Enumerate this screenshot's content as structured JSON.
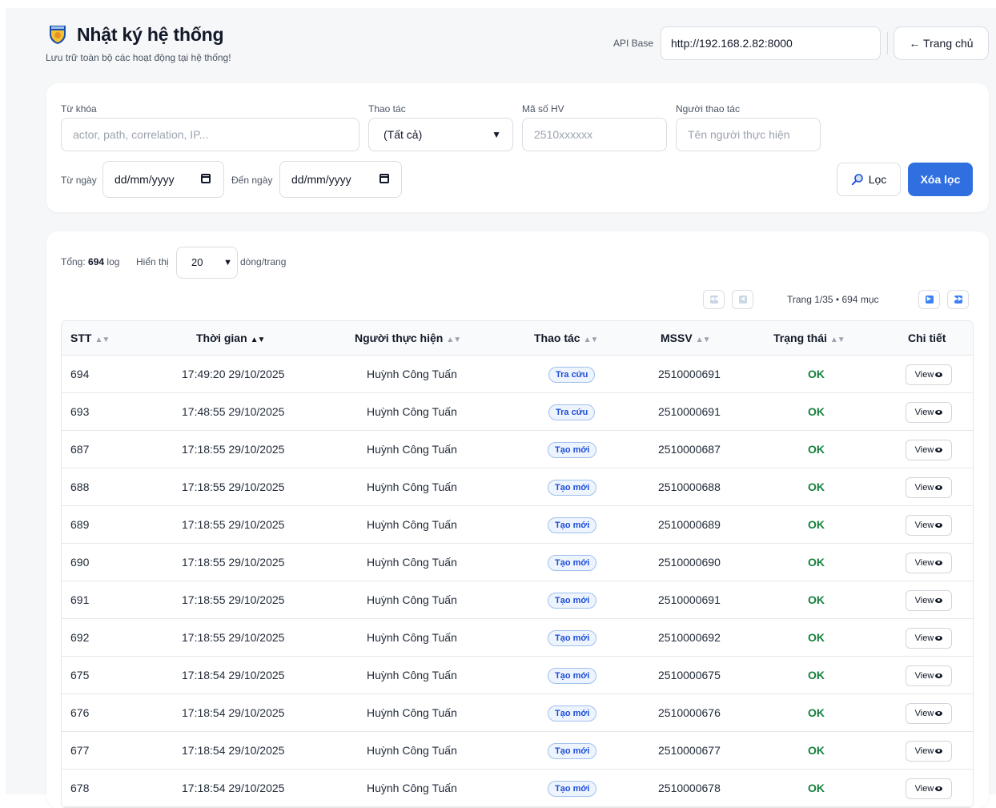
{
  "header": {
    "title": "Nhật ký hệ thống",
    "subtitle": "Lưu trữ toàn bộ các hoạt động tại hệ thống!",
    "api_label": "API Base",
    "api_value": "http://192.168.2.82:8000",
    "home_label": "← Trang chủ"
  },
  "filters": {
    "keyword_label": "Từ khóa",
    "keyword_placeholder": "actor, path, correlation, IP...",
    "action_label": "Thao tác",
    "action_value": "(Tất cả)",
    "student_label": "Mã số HV",
    "student_placeholder": "2510xxxxxx",
    "actor_label": "Người thao tác",
    "actor_placeholder": "Tên người thực hiện",
    "from_label": "Từ ngày",
    "from_value": "dd/mm/yyyy",
    "to_label": "Đến ngày",
    "to_value": "dd/mm/yyyy",
    "filter_btn": "Lọc",
    "clear_btn": "Xóa lọc"
  },
  "summary": {
    "total_prefix": "Tổng:",
    "total_count": "694",
    "total_suffix": "log",
    "show_label": "Hiển thị",
    "page_size": "20",
    "rows_label": "dòng/trang",
    "page_info": "Trang 1/35 • 694 mục"
  },
  "table": {
    "headers": [
      "STT",
      "Thời gian",
      "Người thực hiện",
      "Thao tác",
      "MSSV",
      "Trạng thái",
      "Chi tiết"
    ],
    "view_label": "View",
    "rows": [
      {
        "stt": "694",
        "time": "17:49:20 29/10/2025",
        "actor": "Huỳnh Công Tuấn",
        "action": "Tra cứu",
        "mssv": "2510000691",
        "status": "OK"
      },
      {
        "stt": "693",
        "time": "17:48:55 29/10/2025",
        "actor": "Huỳnh Công Tuấn",
        "action": "Tra cứu",
        "mssv": "2510000691",
        "status": "OK"
      },
      {
        "stt": "687",
        "time": "17:18:55 29/10/2025",
        "actor": "Huỳnh Công Tuấn",
        "action": "Tạo mới",
        "mssv": "2510000687",
        "status": "OK"
      },
      {
        "stt": "688",
        "time": "17:18:55 29/10/2025",
        "actor": "Huỳnh Công Tuấn",
        "action": "Tạo mới",
        "mssv": "2510000688",
        "status": "OK"
      },
      {
        "stt": "689",
        "time": "17:18:55 29/10/2025",
        "actor": "Huỳnh Công Tuấn",
        "action": "Tạo mới",
        "mssv": "2510000689",
        "status": "OK"
      },
      {
        "stt": "690",
        "time": "17:18:55 29/10/2025",
        "actor": "Huỳnh Công Tuấn",
        "action": "Tạo mới",
        "mssv": "2510000690",
        "status": "OK"
      },
      {
        "stt": "691",
        "time": "17:18:55 29/10/2025",
        "actor": "Huỳnh Công Tuấn",
        "action": "Tạo mới",
        "mssv": "2510000691",
        "status": "OK"
      },
      {
        "stt": "692",
        "time": "17:18:55 29/10/2025",
        "actor": "Huỳnh Công Tuấn",
        "action": "Tạo mới",
        "mssv": "2510000692",
        "status": "OK"
      },
      {
        "stt": "675",
        "time": "17:18:54 29/10/2025",
        "actor": "Huỳnh Công Tuấn",
        "action": "Tạo mới",
        "mssv": "2510000675",
        "status": "OK"
      },
      {
        "stt": "676",
        "time": "17:18:54 29/10/2025",
        "actor": "Huỳnh Công Tuấn",
        "action": "Tạo mới",
        "mssv": "2510000676",
        "status": "OK"
      },
      {
        "stt": "677",
        "time": "17:18:54 29/10/2025",
        "actor": "Huỳnh Công Tuấn",
        "action": "Tạo mới",
        "mssv": "2510000677",
        "status": "OK"
      },
      {
        "stt": "678",
        "time": "17:18:54 29/10/2025",
        "actor": "Huỳnh Công Tuấn",
        "action": "Tạo mới",
        "mssv": "2510000678",
        "status": "OK"
      }
    ]
  },
  "icons": {
    "logo": "university-shield-logo",
    "filter": "search-icon",
    "view": "eye-icon",
    "calendar": "calendar-icon"
  },
  "colors": {
    "primary": "#2f6fe0",
    "ok": "#15803d",
    "badge_text": "#1d4ed8",
    "badge_bg": "#eef4fd"
  }
}
